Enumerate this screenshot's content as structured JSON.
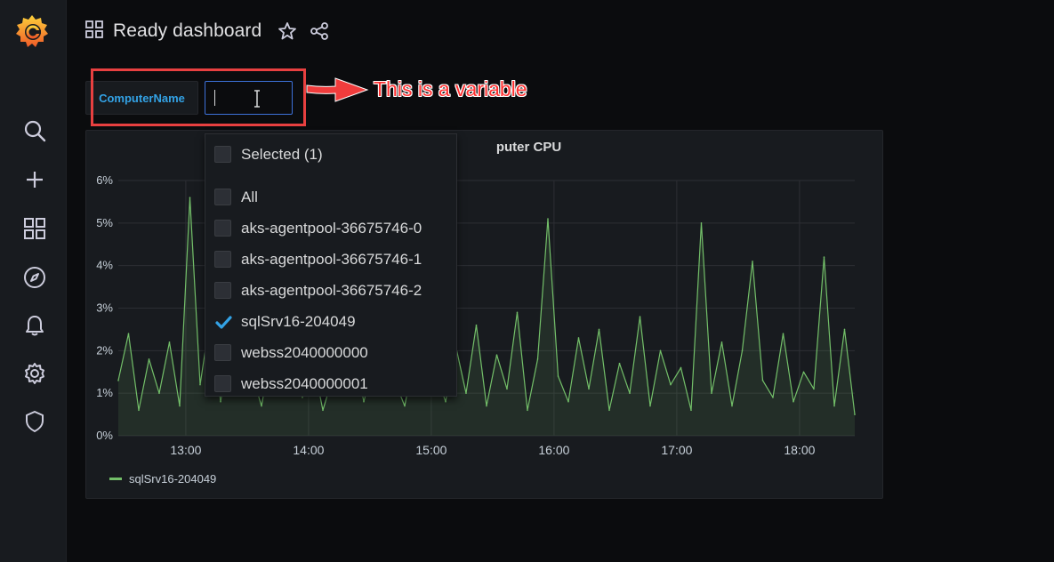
{
  "dashboard": {
    "title": "Ready dashboard"
  },
  "variable": {
    "label": "ComputerName",
    "value": ""
  },
  "annotation": {
    "text": "This is a variable"
  },
  "panel": {
    "title_visible": "puter CPU",
    "legend": "sqlSrv16-204049"
  },
  "dropdown": {
    "header": "Selected (1)",
    "options": [
      {
        "label": "All",
        "checked": false
      },
      {
        "label": "aks-agentpool-36675746-0",
        "checked": false
      },
      {
        "label": "aks-agentpool-36675746-1",
        "checked": false
      },
      {
        "label": "aks-agentpool-36675746-2",
        "checked": false
      },
      {
        "label": "sqlSrv16-204049",
        "checked": true
      },
      {
        "label": "webss2040000000",
        "checked": false
      },
      {
        "label": "webss2040000001",
        "checked": false
      }
    ]
  },
  "colors": {
    "series": "#73bf69",
    "accent": "#33a2e5",
    "annotation": "#ff3030"
  },
  "chart_data": {
    "type": "line",
    "y_ticks": [
      "0%",
      "1%",
      "2%",
      "3%",
      "4%",
      "5%",
      "6%"
    ],
    "x_ticks": [
      "13:00",
      "14:00",
      "15:00",
      "16:00",
      "17:00",
      "18:00"
    ],
    "ylim": [
      0,
      6
    ],
    "x_range": [
      "12:27",
      "18:27"
    ],
    "series": [
      {
        "name": "sqlSrv16-204049",
        "x": [
          "12:27",
          "12:32",
          "12:37",
          "12:42",
          "12:47",
          "12:52",
          "12:57",
          "13:02",
          "13:07",
          "13:12",
          "13:17",
          "13:22",
          "13:27",
          "13:32",
          "13:37",
          "13:42",
          "13:47",
          "13:52",
          "13:57",
          "14:02",
          "14:07",
          "14:12",
          "14:17",
          "14:22",
          "14:27",
          "14:32",
          "14:37",
          "14:42",
          "14:47",
          "14:52",
          "14:57",
          "15:02",
          "15:07",
          "15:12",
          "15:17",
          "15:22",
          "15:27",
          "15:32",
          "15:37",
          "15:42",
          "15:47",
          "15:52",
          "15:57",
          "16:02",
          "16:07",
          "16:12",
          "16:17",
          "16:22",
          "16:27",
          "16:32",
          "16:37",
          "16:42",
          "16:47",
          "16:52",
          "16:57",
          "17:02",
          "17:07",
          "17:12",
          "17:17",
          "17:22",
          "17:27",
          "17:32",
          "17:37",
          "17:42",
          "17:47",
          "17:52",
          "17:57",
          "18:02",
          "18:07",
          "18:12",
          "18:17",
          "18:22",
          "18:27"
        ],
        "values": [
          1.3,
          2.4,
          0.6,
          1.8,
          1.0,
          2.2,
          0.7,
          5.6,
          1.2,
          2.8,
          0.8,
          2.1,
          1.0,
          1.5,
          0.7,
          2.0,
          1.2,
          1.6,
          0.9,
          1.8,
          0.6,
          1.4,
          1.1,
          2.0,
          0.8,
          1.7,
          1.0,
          1.3,
          0.7,
          1.9,
          1.2,
          1.5,
          0.8,
          2.1,
          1.0,
          2.6,
          0.7,
          1.9,
          1.1,
          2.9,
          0.6,
          1.8,
          5.1,
          1.4,
          0.8,
          2.3,
          1.1,
          2.5,
          0.6,
          1.7,
          1.0,
          2.8,
          0.7,
          2.0,
          1.2,
          1.6,
          0.6,
          5.0,
          1.0,
          2.2,
          0.7,
          2.0,
          4.1,
          1.3,
          0.9,
          2.4,
          0.8,
          1.5,
          1.1,
          4.2,
          0.7,
          2.5,
          0.5
        ]
      }
    ]
  }
}
